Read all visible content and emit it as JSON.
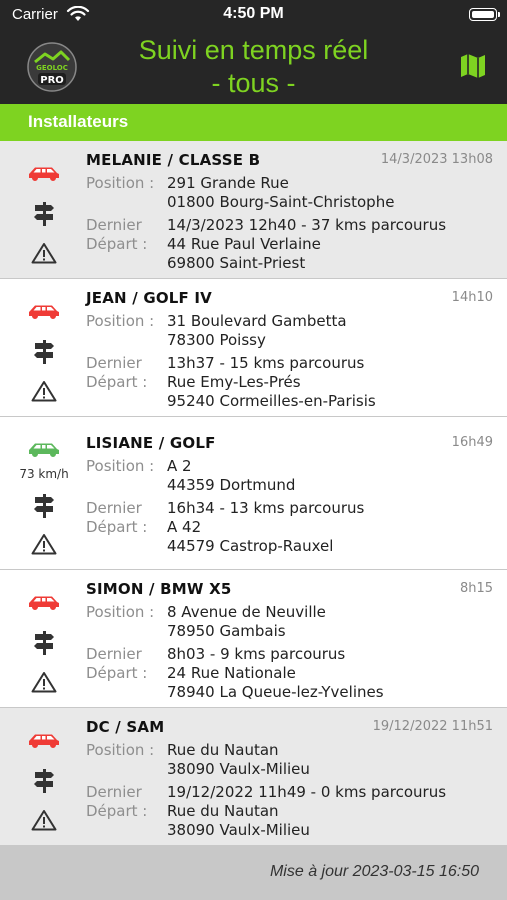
{
  "status": {
    "carrier": "Carrier",
    "time": "4:50 PM"
  },
  "header": {
    "title_line1": "Suivi en temps réel",
    "title_line2": "- tous -",
    "logo_text_top": "GEOLOC",
    "logo_text_bottom": "PRO"
  },
  "section": {
    "title": "Installateurs"
  },
  "labels": {
    "position": "Position :",
    "dernier": "Dernier",
    "depart": "Départ :"
  },
  "vehicles": [
    {
      "name": "MELANIE / CLASSE B",
      "time": "14/3/2023 13h08",
      "status_color": "#ef3b36",
      "speed": "",
      "pos_line1": "291 Grande Rue",
      "pos_line2": "01800 Bourg-Saint-Christophe",
      "last": "14/3/2023 12h40 - 37 kms parcourus",
      "dep_line1": "44 Rue Paul Verlaine",
      "dep_line2": "69800 Saint-Priest"
    },
    {
      "name": "JEAN / GOLF IV",
      "time": "14h10",
      "status_color": "#ef3b36",
      "speed": "",
      "pos_line1": "31 Boulevard Gambetta",
      "pos_line2": "78300 Poissy",
      "last": "13h37 - 15 kms parcourus",
      "dep_line1": "Rue Emy-Les-Prés",
      "dep_line2": "95240 Cormeilles-en-Parisis"
    },
    {
      "name": "LISIANE / GOLF",
      "time": "16h49",
      "status_color": "#5cb85c",
      "speed": "73 km/h",
      "pos_line1": "A 2",
      "pos_line2": "44359 Dortmund",
      "last": "16h34 - 13 kms parcourus",
      "dep_line1": "A 42",
      "dep_line2": "44579 Castrop-Rauxel"
    },
    {
      "name": "SIMON / BMW X5",
      "time": "8h15",
      "status_color": "#ef3b36",
      "speed": "",
      "pos_line1": "8 Avenue de Neuville",
      "pos_line2": "78950 Gambais",
      "last": "8h03 - 9 kms parcourus",
      "dep_line1": "24 Rue Nationale",
      "dep_line2": "78940 La Queue-lez-Yvelines"
    },
    {
      "name": "DC / SAM",
      "time": "19/12/2022 11h51",
      "status_color": "#ef3b36",
      "speed": "",
      "pos_line1": "Rue du Nautan",
      "pos_line2": "38090 Vaulx-Milieu",
      "last": "19/12/2022 11h49 - 0 kms parcourus",
      "dep_line1": "Rue du Nautan",
      "dep_line2": "38090 Vaulx-Milieu"
    }
  ],
  "footer": {
    "updated": "Mise à jour 2023-03-15 16:50"
  },
  "colors": {
    "accent": "#7ed321",
    "bar": "#262626",
    "car_stopped": "#ef3b36",
    "car_moving": "#5cb85c"
  },
  "icons": [
    "wifi-icon",
    "battery-icon",
    "app-logo",
    "map-icon",
    "car-icon",
    "signpost-icon",
    "warning-icon"
  ]
}
